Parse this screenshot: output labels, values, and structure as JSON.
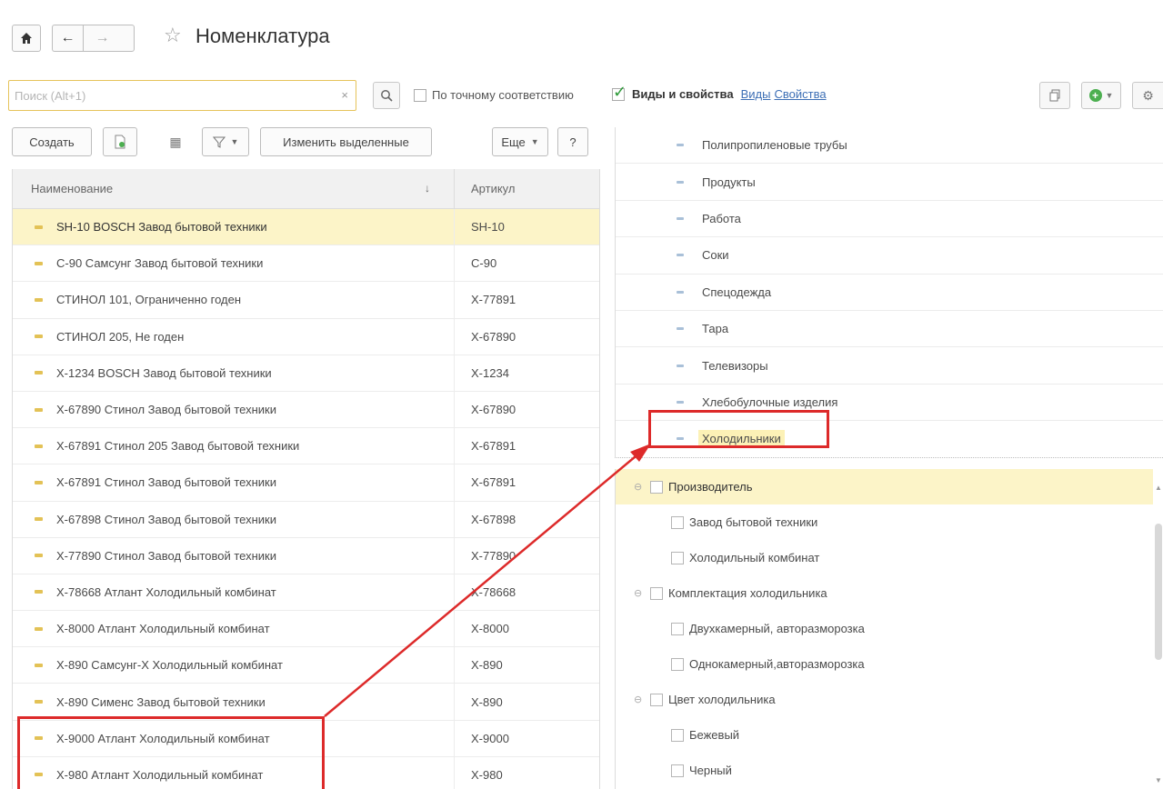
{
  "window": {
    "title": "Номенклатура"
  },
  "nav": {
    "home_icon": "home-icon",
    "back_icon": "arrow-left-icon",
    "forward_icon": "arrow-right-icon",
    "favorite_icon": "star-icon"
  },
  "search": {
    "placeholder": "Поиск (Alt+1)",
    "value": "",
    "clear_glyph": "×",
    "exact_match_label": "По точному соответствию",
    "exact_match_checked": false
  },
  "kinds_panel": {
    "enabled_label": "Виды и свойства",
    "enabled_checked": true,
    "link_kinds": "Виды",
    "link_properties": "Свойства"
  },
  "toolbar": {
    "create_label": "Создать",
    "change_selected_label": "Изменить выделенные",
    "more_label": "Еще",
    "help_label": "?"
  },
  "table": {
    "columns": {
      "name": "Наименование",
      "article": "Артикул"
    },
    "rows": [
      {
        "name": "SH-10 BOSCH Завод бытовой техники",
        "article": "SH-10"
      },
      {
        "name": "С-90 Самсунг Завод бытовой техники",
        "article": "С-90"
      },
      {
        "name": "СТИНОЛ 101, Ограниченно годен",
        "article": "Х-77891"
      },
      {
        "name": "СТИНОЛ 205, Не годен",
        "article": "Х-67890"
      },
      {
        "name": "Х-1234 BOSCH Завод бытовой техники",
        "article": "Х-1234"
      },
      {
        "name": "Х-67890 Стинол Завод бытовой техники",
        "article": "Х-67890"
      },
      {
        "name": "Х-67891 Стинол 205 Завод бытовой техники",
        "article": "Х-67891"
      },
      {
        "name": "Х-67891 Стинол Завод бытовой техники",
        "article": "Х-67891"
      },
      {
        "name": "Х-67898 Стинол Завод бытовой техники",
        "article": "Х-67898"
      },
      {
        "name": "Х-77890 Стинол Завод бытовой техники",
        "article": "Х-77890"
      },
      {
        "name": "Х-78668 Атлант Холодильный комбинат",
        "article": "Х-78668"
      },
      {
        "name": "Х-8000 Атлант Холодильный комбинат",
        "article": "Х-8000"
      },
      {
        "name": "Х-890 Самсунг-Х Холодильный комбинат",
        "article": "Х-890"
      },
      {
        "name": "Х-890 Сименс Завод бытовой техники",
        "article": "Х-890"
      },
      {
        "name": "Х-9000 Атлант Холодильный комбинат",
        "article": "Х-9000"
      },
      {
        "name": "Х-980 Атлант Холодильный комбинат",
        "article": "Х-980"
      }
    ]
  },
  "kinds": {
    "items": [
      {
        "label": "Полипропиленовые трубы"
      },
      {
        "label": "Продукты"
      },
      {
        "label": "Работа"
      },
      {
        "label": "Соки"
      },
      {
        "label": "Спецодежда"
      },
      {
        "label": "Тара"
      },
      {
        "label": "Телевизоры"
      },
      {
        "label": "Хлебобулочные изделия"
      },
      {
        "label": "Холодильники"
      }
    ]
  },
  "properties": {
    "g1": {
      "label": "Производитель",
      "children": [
        "Завод бытовой техники",
        "Холодильный комбинат"
      ]
    },
    "g2": {
      "label": "Комплектация холодильника",
      "children": [
        "Двухкамерный, авторазморозка",
        "Однокамерный,авторазморозка"
      ]
    },
    "g3": {
      "label": "Цвет холодильника",
      "children": [
        "Бежевый",
        "Черный"
      ]
    }
  },
  "colors": {
    "selected_row": "#fcf4c8",
    "annotation": "#dd2a2a",
    "link": "#3d6fb5",
    "check_green": "#2f9b3a"
  }
}
